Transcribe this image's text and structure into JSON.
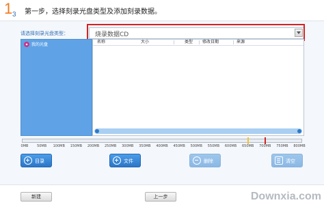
{
  "step": {
    "number": "1",
    "sub": "3",
    "text": "第一步，选择刻录光盘类型及添加刻录数据。"
  },
  "disc_type": {
    "label": "请选择刻录光盘类型：",
    "value": "烧录数据CD"
  },
  "tree": {
    "items": [
      {
        "label": "我的光盘",
        "icon": "disc-icon"
      }
    ]
  },
  "file_table": {
    "columns": [
      "名称",
      "大小",
      "类型",
      "修改日期",
      "来源"
    ],
    "rows": []
  },
  "capacity": {
    "ticks": [
      "0MB",
      "50MB",
      "100MB",
      "150MB",
      "200MB",
      "250MB",
      "300MB",
      "350MB",
      "400MB",
      "450MB",
      "500MB",
      "550MB",
      "600MB",
      "650MB",
      "700MB",
      "750MB",
      "800MB"
    ],
    "markers": [
      {
        "value_mb": 650,
        "color": "#f3c12b"
      },
      {
        "value_mb": 700,
        "color": "#d32222"
      }
    ]
  },
  "actions": [
    {
      "label": "目录",
      "icon": "add-circle-icon",
      "enabled": true
    },
    {
      "label": "文件",
      "icon": "add-circle-icon",
      "enabled": true
    },
    {
      "label": "删除",
      "icon": "remove-circle-icon",
      "enabled": false
    },
    {
      "label": "清空",
      "icon": "clear-list-icon",
      "enabled": false
    }
  ],
  "footer": {
    "new_label": "新建",
    "prev_label": "上一步",
    "watermark": "Downxia.com"
  },
  "colors": {
    "accent": "#2c76c8",
    "highlight": "#d32222",
    "tree_bg": "#5fa3e6",
    "step_orange": "#f07a1e"
  }
}
